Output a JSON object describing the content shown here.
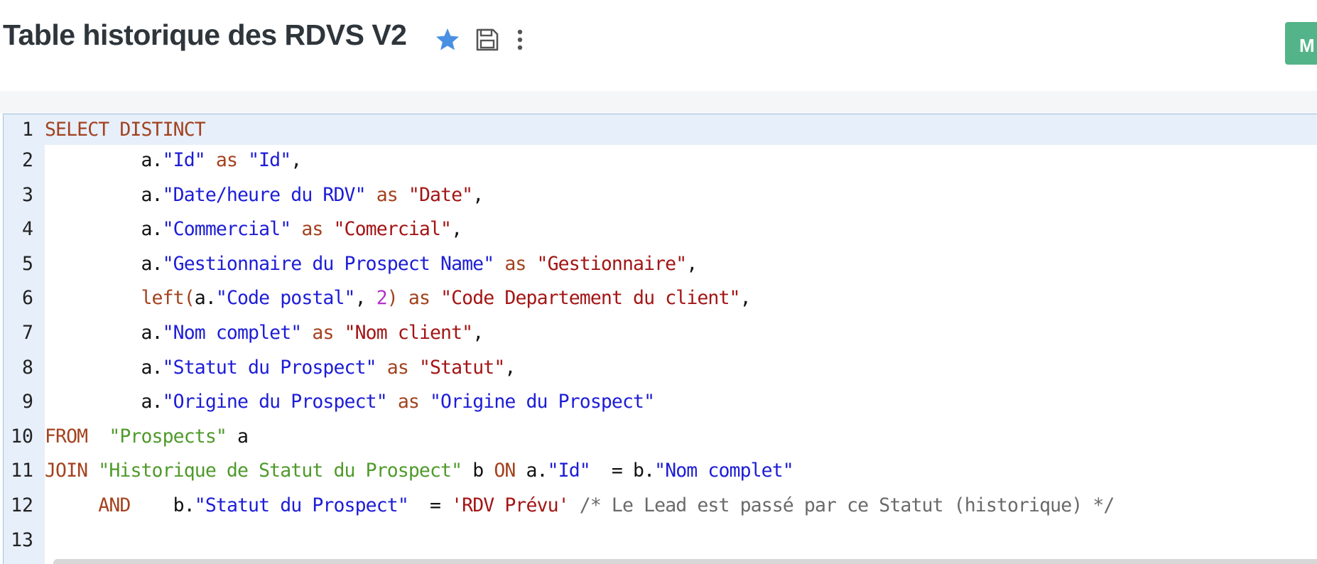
{
  "header": {
    "title": "Table historique des RDVS V2",
    "favorite_icon": "star-icon",
    "save_icon": "floppy-disk-icon",
    "more_icon": "vertical-ellipsis-icon",
    "action_label": "M",
    "colors": {
      "star": "#4a90e2",
      "action": "#54b489"
    }
  },
  "editor": {
    "line_numbers": [
      "1",
      "2",
      "3",
      "4",
      "5",
      "6",
      "7",
      "8",
      "9",
      "10",
      "11",
      "12",
      "13"
    ],
    "lines": [
      [
        {
          "t": "kw",
          "v": "SELECT DISTINCT"
        }
      ],
      [
        {
          "t": "p",
          "v": "         a."
        },
        {
          "t": "id",
          "v": "\"Id\""
        },
        {
          "t": "p",
          "v": " "
        },
        {
          "t": "kw",
          "v": "as"
        },
        {
          "t": "p",
          "v": " "
        },
        {
          "t": "id",
          "v": "\"Id\""
        },
        {
          "t": "p",
          "v": ","
        }
      ],
      [
        {
          "t": "p",
          "v": "         a."
        },
        {
          "t": "id",
          "v": "\"Date/heure du RDV\""
        },
        {
          "t": "p",
          "v": " "
        },
        {
          "t": "kw",
          "v": "as"
        },
        {
          "t": "p",
          "v": " "
        },
        {
          "t": "str",
          "v": "\"Date\""
        },
        {
          "t": "p",
          "v": ","
        }
      ],
      [
        {
          "t": "p",
          "v": "         a."
        },
        {
          "t": "id",
          "v": "\"Commercial\""
        },
        {
          "t": "p",
          "v": " "
        },
        {
          "t": "kw",
          "v": "as"
        },
        {
          "t": "p",
          "v": " "
        },
        {
          "t": "str",
          "v": "\"Comercial\""
        },
        {
          "t": "p",
          "v": ","
        }
      ],
      [
        {
          "t": "p",
          "v": "         a."
        },
        {
          "t": "id",
          "v": "\"Gestionnaire du Prospect Name\""
        },
        {
          "t": "p",
          "v": " "
        },
        {
          "t": "kw",
          "v": "as"
        },
        {
          "t": "p",
          "v": " "
        },
        {
          "t": "str",
          "v": "\"Gestionnaire\""
        },
        {
          "t": "p",
          "v": ","
        }
      ],
      [
        {
          "t": "p",
          "v": "         "
        },
        {
          "t": "fn",
          "v": "left("
        },
        {
          "t": "p",
          "v": "a."
        },
        {
          "t": "id",
          "v": "\"Code postal\""
        },
        {
          "t": "p",
          "v": ", "
        },
        {
          "t": "num",
          "v": "2"
        },
        {
          "t": "fn",
          "v": ")"
        },
        {
          "t": "p",
          "v": " "
        },
        {
          "t": "kw",
          "v": "as"
        },
        {
          "t": "p",
          "v": " "
        },
        {
          "t": "str",
          "v": "\"Code Departement du client\""
        },
        {
          "t": "p",
          "v": ","
        }
      ],
      [
        {
          "t": "p",
          "v": "         a."
        },
        {
          "t": "id",
          "v": "\"Nom complet\""
        },
        {
          "t": "p",
          "v": " "
        },
        {
          "t": "kw",
          "v": "as"
        },
        {
          "t": "p",
          "v": " "
        },
        {
          "t": "str",
          "v": "\"Nom client\""
        },
        {
          "t": "p",
          "v": ","
        }
      ],
      [
        {
          "t": "p",
          "v": "         a."
        },
        {
          "t": "id",
          "v": "\"Statut du Prospect\""
        },
        {
          "t": "p",
          "v": " "
        },
        {
          "t": "kw",
          "v": "as"
        },
        {
          "t": "p",
          "v": " "
        },
        {
          "t": "str",
          "v": "\"Statut\""
        },
        {
          "t": "p",
          "v": ","
        }
      ],
      [
        {
          "t": "p",
          "v": "         a."
        },
        {
          "t": "id",
          "v": "\"Origine du Prospect\""
        },
        {
          "t": "p",
          "v": " "
        },
        {
          "t": "kw",
          "v": "as"
        },
        {
          "t": "p",
          "v": " "
        },
        {
          "t": "id",
          "v": "\"Origine du Prospect\""
        }
      ],
      [
        {
          "t": "kw",
          "v": "FROM"
        },
        {
          "t": "p",
          "v": "  "
        },
        {
          "t": "tbl",
          "v": "\"Prospects\""
        },
        {
          "t": "p",
          "v": " a"
        }
      ],
      [
        {
          "t": "kw",
          "v": "JOIN"
        },
        {
          "t": "p",
          "v": " "
        },
        {
          "t": "tbl",
          "v": "\"Historique de Statut du Prospect\""
        },
        {
          "t": "p",
          "v": " b "
        },
        {
          "t": "kw",
          "v": "ON"
        },
        {
          "t": "p",
          "v": " a."
        },
        {
          "t": "id",
          "v": "\"Id\""
        },
        {
          "t": "p",
          "v": "  = b."
        },
        {
          "t": "id",
          "v": "\"Nom complet\""
        }
      ],
      [
        {
          "t": "p",
          "v": "     "
        },
        {
          "t": "kw",
          "v": "AND"
        },
        {
          "t": "p",
          "v": "    b."
        },
        {
          "t": "id",
          "v": "\"Statut du Prospect\""
        },
        {
          "t": "p",
          "v": "  = "
        },
        {
          "t": "str",
          "v": "'RDV Prévu'"
        },
        {
          "t": "p",
          "v": " "
        },
        {
          "t": "cm",
          "v": "/* Le Lead est passé par ce Statut (historique) */"
        }
      ],
      []
    ]
  }
}
